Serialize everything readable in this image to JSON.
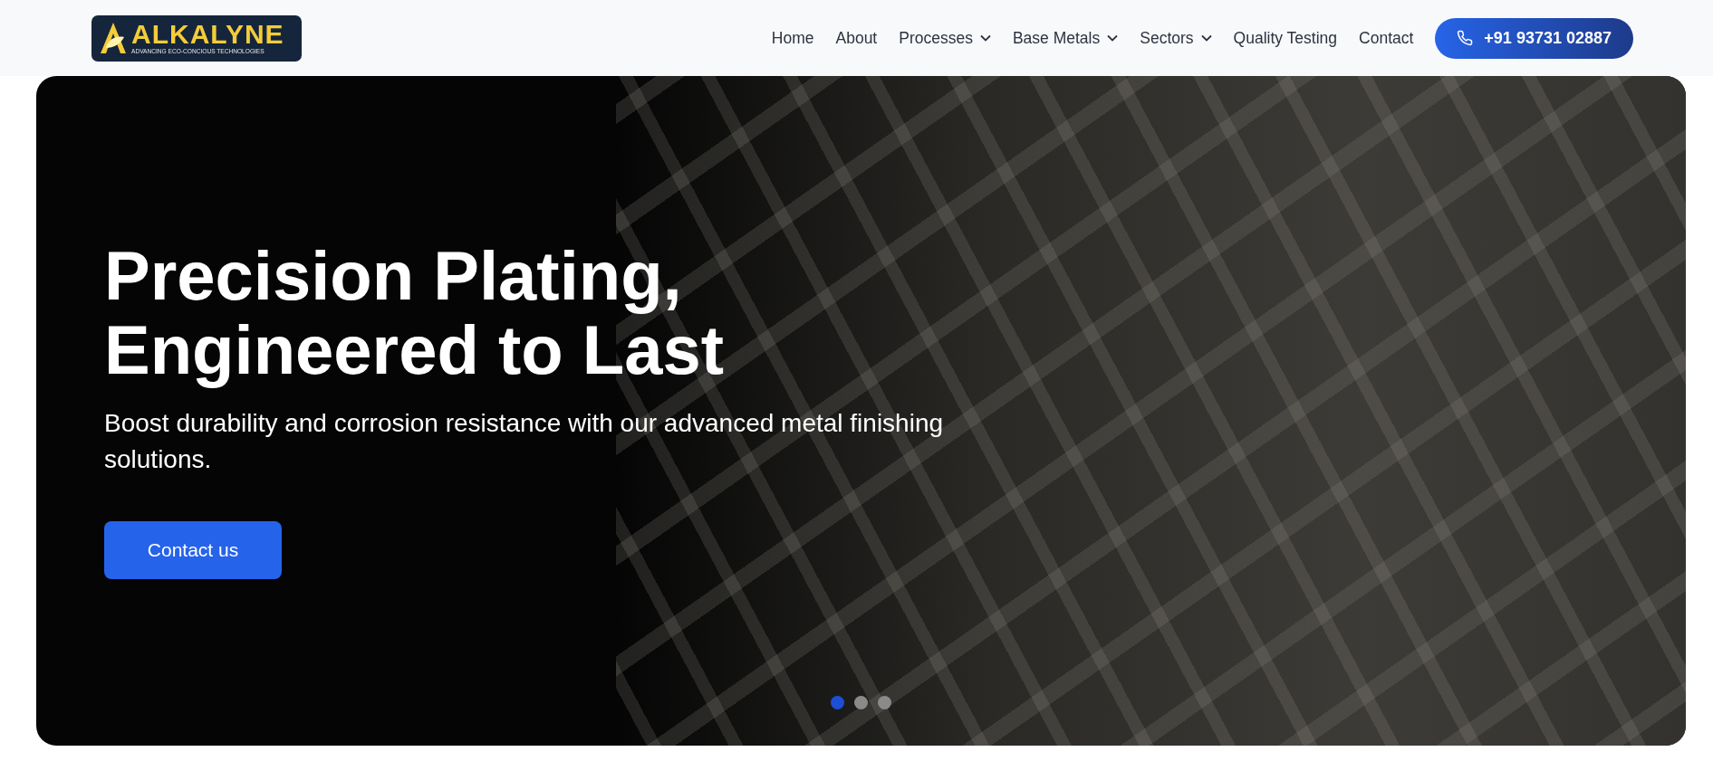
{
  "header": {
    "logo": {
      "name": "ALKALYNE",
      "tagline": "ADVANCING ECO-CONCIOUS TECHNOLOGIES"
    },
    "nav": [
      {
        "label": "Home",
        "dropdown": false
      },
      {
        "label": "About",
        "dropdown": false
      },
      {
        "label": "Processes",
        "dropdown": true
      },
      {
        "label": "Base Metals",
        "dropdown": true
      },
      {
        "label": "Sectors",
        "dropdown": true
      },
      {
        "label": "Quality Testing",
        "dropdown": false
      },
      {
        "label": "Contact",
        "dropdown": false
      }
    ],
    "phone_button": "+91 93731 02887"
  },
  "hero": {
    "title": "Precision Plating, Engineered to Last",
    "subtitle": "Boost durability and corrosion resistance with our advanced metal finishing solutions.",
    "button": "Contact us",
    "slides": [
      {
        "selected": true
      },
      {
        "selected": false
      },
      {
        "selected": false
      }
    ]
  }
}
